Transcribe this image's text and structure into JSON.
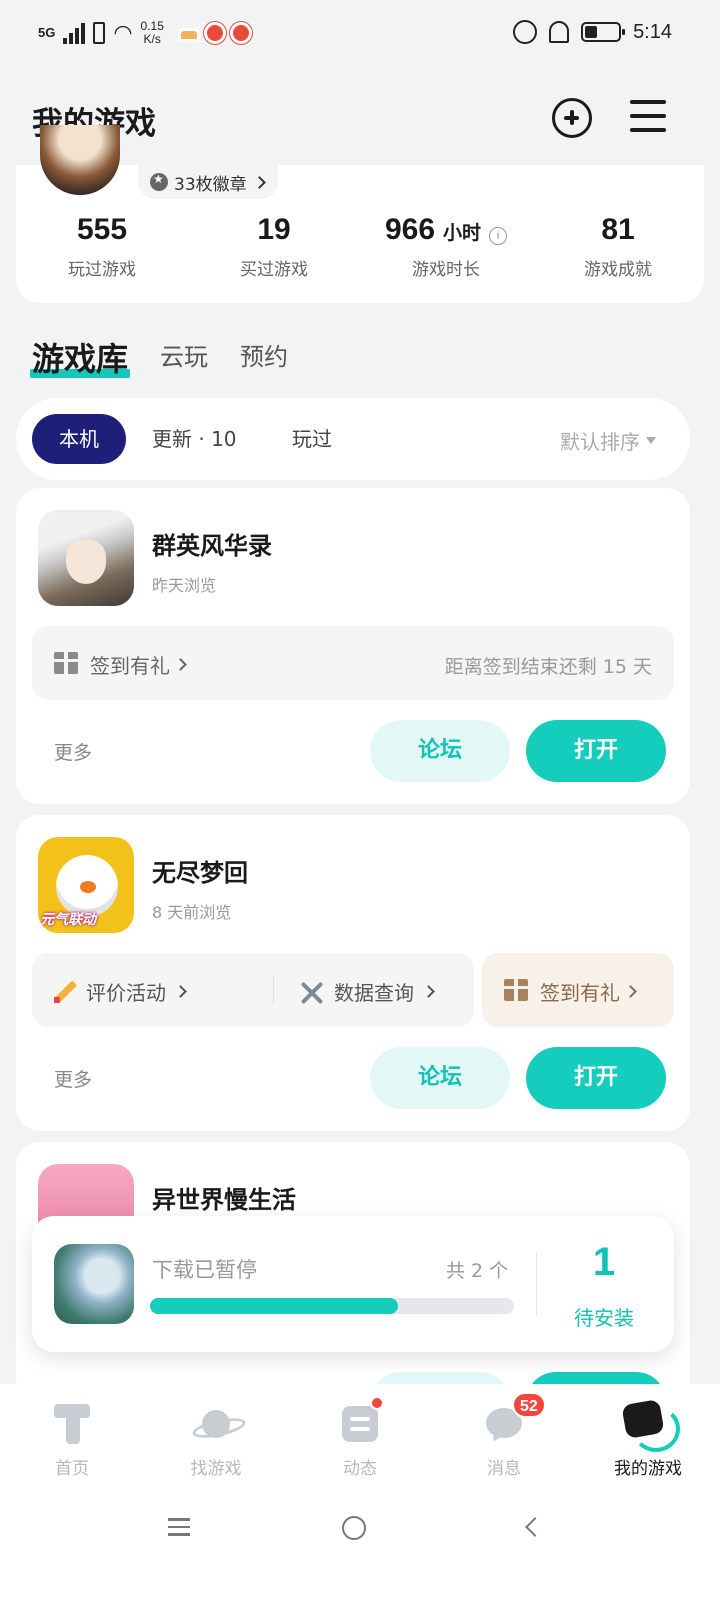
{
  "status_bar": {
    "signal": "5G",
    "net_speed": "0.15",
    "net_unit": "K/s",
    "time": "5:14"
  },
  "header": {
    "title": "我的游戏"
  },
  "profile": {
    "badges_label": "33枚徽章"
  },
  "stats": [
    {
      "value": "555",
      "unit": "",
      "label": "玩过游戏"
    },
    {
      "value": "19",
      "unit": "",
      "label": "买过游戏"
    },
    {
      "value": "966",
      "unit": "小时",
      "label": "游戏时长"
    },
    {
      "value": "81",
      "unit": "",
      "label": "游戏成就"
    }
  ],
  "library_tabs": [
    "游戏库",
    "云玩",
    "预约"
  ],
  "filters": {
    "chips": [
      "本机",
      "更新 · 10",
      "玩过"
    ],
    "sort_label": "默认排序"
  },
  "games": [
    {
      "name": "群英风华录",
      "subtitle": "昨天浏览",
      "signin_label": "签到有礼",
      "signin_remaining": "距离签到结束还剩 15 天",
      "more": "更多",
      "forum": "论坛",
      "open": "打开"
    },
    {
      "name": "无尽梦回",
      "subtitle": "8 天前浏览",
      "icon_text": "元气联动",
      "review_label": "评价活动",
      "data_label": "数据查询",
      "signin_label": "签到有礼",
      "more": "更多",
      "forum": "论坛",
      "open": "打开"
    },
    {
      "name": "异世界慢生活"
    }
  ],
  "download": {
    "status": "下载已暂停",
    "total": "共 2 个",
    "progress": 0.68,
    "pending_count": "1",
    "pending_label": "待安装"
  },
  "bottom_nav": [
    {
      "label": "首页",
      "icon": "home-icon"
    },
    {
      "label": "找游戏",
      "icon": "planet-icon"
    },
    {
      "label": "动态",
      "icon": "feed-icon"
    },
    {
      "label": "消息",
      "icon": "chat-icon",
      "badge": "52"
    },
    {
      "label": "我的游戏",
      "icon": "my-games-icon",
      "active": true
    }
  ],
  "colors": {
    "accent": "#14cdbd",
    "active_chip": "#1f1f7a",
    "badge_red": "#f2453d"
  }
}
